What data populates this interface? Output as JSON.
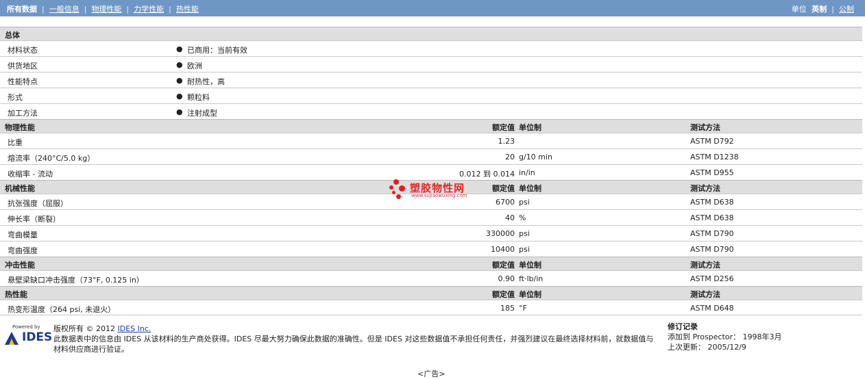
{
  "nav": {
    "tabs": [
      {
        "label": "所有数据",
        "active": true
      },
      {
        "label": "一般信息"
      },
      {
        "label": "物理性能"
      },
      {
        "label": "力学性能"
      },
      {
        "label": "热性能"
      }
    ],
    "units_label": "单位",
    "unit_active": "英制",
    "unit_link": "公制"
  },
  "sections": {
    "general": {
      "title": "总体",
      "rows": [
        {
          "name": "材料状态",
          "value": "已商用：当前有效"
        },
        {
          "name": "供货地区",
          "value": "欧洲"
        },
        {
          "name": "性能特点",
          "value": "耐热性，高"
        },
        {
          "name": "形式",
          "value": "颗粒料"
        },
        {
          "name": "加工方法",
          "value": "注射成型"
        }
      ]
    },
    "col_headers": {
      "value": "额定值",
      "unit": "单位制",
      "test": "测试方法"
    },
    "physical": {
      "title": "物理性能",
      "rows": [
        {
          "name": "比重",
          "value": "1.23",
          "unit": "",
          "test": "ASTM D792"
        },
        {
          "name": "熔流率（240°C/5.0 kg）",
          "value": "20",
          "unit": "g/10 min",
          "test": "ASTM D1238"
        },
        {
          "name": "收缩率 - 流动",
          "value": "0.012 到  0.014",
          "unit": "in/in",
          "test": "ASTM D955"
        }
      ]
    },
    "mechanical": {
      "title": "机械性能",
      "rows": [
        {
          "name": "抗张强度（屈服）",
          "value": "6700",
          "unit": "psi",
          "test": "ASTM D638"
        },
        {
          "name": "伸长率（断裂）",
          "value": "40",
          "unit": "%",
          "test": "ASTM D638"
        },
        {
          "name": "弯曲模量",
          "value": "330000",
          "unit": "psi",
          "test": "ASTM D790"
        },
        {
          "name": "弯曲强度",
          "value": "10400",
          "unit": "psi",
          "test": "ASTM D790"
        }
      ]
    },
    "impact": {
      "title": "冲击性能",
      "rows": [
        {
          "name": "悬壁梁缺口冲击强度（73°F, 0.125 in）",
          "value": "0.90",
          "unit": "ft·lb/in",
          "test": "ASTM D256"
        }
      ]
    },
    "thermal": {
      "title": "热性能",
      "rows": [
        {
          "name": "热变形温度（264 psi, 未退火）",
          "value": "185",
          "unit": "°F",
          "test": "ASTM D648"
        }
      ]
    }
  },
  "watermark": {
    "text": "塑胶物性网",
    "url": "www.sujiaowuxing.com"
  },
  "footer": {
    "logo_powered": "Powered by",
    "logo_word": "IDES",
    "copyright_prefix": "版权所有  © 2012 ",
    "copyright_link": "IDES Inc.",
    "disclaimer": "此数据表中的信息由  IDES 从该材料的生产商处获得。IDES 尽最大努力确保此数据的准确性。但是  IDES 对这些数据值不承担任何责任，并强烈建议在最终选择材料前，就数据值与材料供应商进行验证。",
    "revision_title": "修订记录",
    "added_label": "添加到  Prospector：",
    "added_value": "1998年3月",
    "updated_label": "上次更新：",
    "updated_value": "2005/12/9"
  },
  "ad_label": "<广告>"
}
